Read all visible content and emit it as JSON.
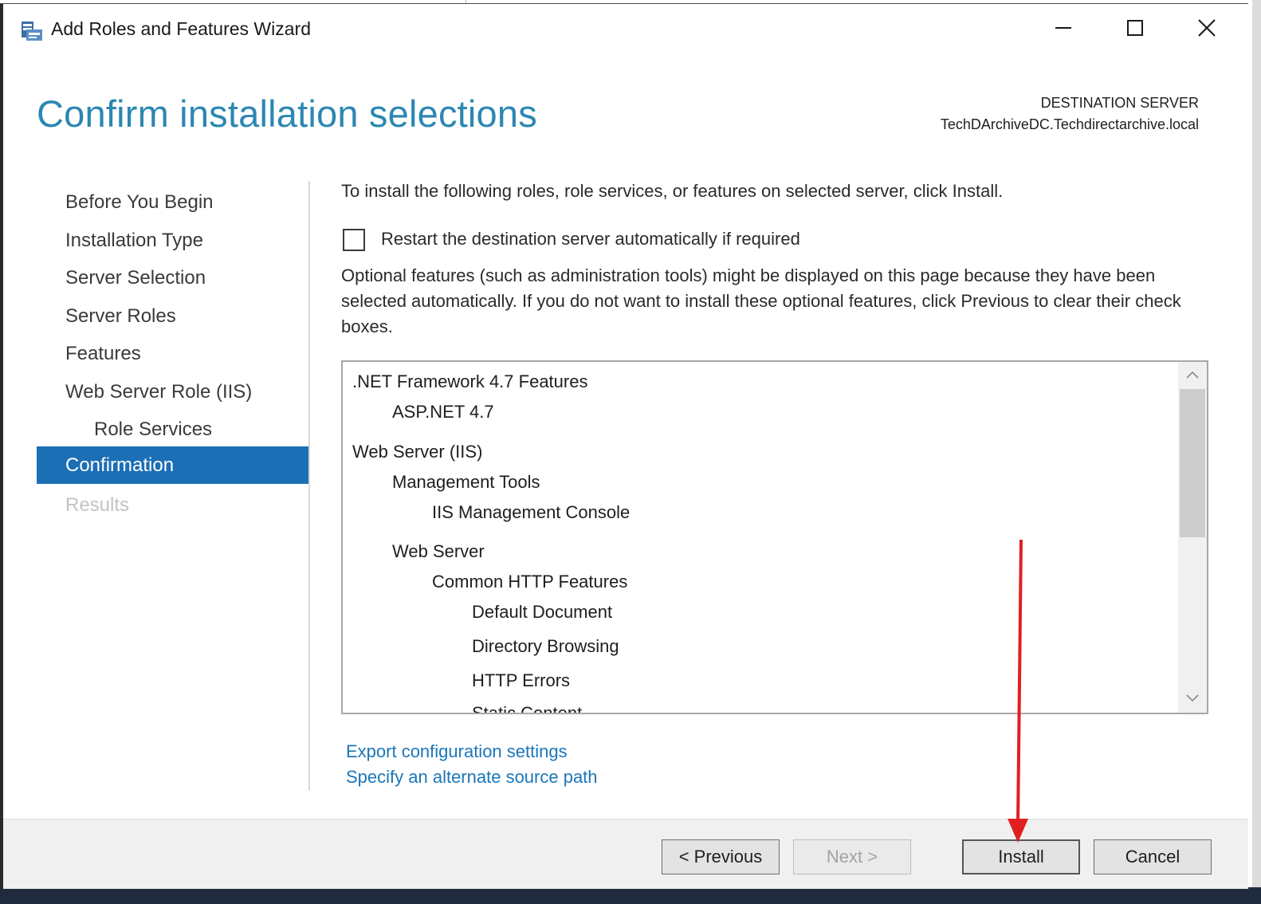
{
  "window": {
    "title": "Add Roles and Features Wizard",
    "minimize_icon": "minimize-icon",
    "maximize_icon": "maximize-icon",
    "close_icon": "close-icon"
  },
  "header": {
    "title": "Confirm installation selections",
    "destination_label": "DESTINATION SERVER",
    "destination_name": "TechDArchiveDC.Techdirectarchive.local"
  },
  "nav": {
    "items": [
      {
        "label": "Before You Begin",
        "state": "normal"
      },
      {
        "label": "Installation Type",
        "state": "normal"
      },
      {
        "label": "Server Selection",
        "state": "normal"
      },
      {
        "label": "Server Roles",
        "state": "normal"
      },
      {
        "label": "Features",
        "state": "normal"
      },
      {
        "label": "Web Server Role (IIS)",
        "state": "normal"
      },
      {
        "label": "Role Services",
        "state": "normal"
      },
      {
        "label": "Confirmation",
        "state": "active"
      },
      {
        "label": "Results",
        "state": "disabled"
      }
    ]
  },
  "main": {
    "instruction": "To install the following roles, role services, or features on selected server, click Install.",
    "restart_checkbox": {
      "label": "Restart the destination server automatically if required",
      "checked": false
    },
    "optional_note": "Optional features (such as administration tools) might be displayed on this page because they have been selected automatically. If you do not want to install these optional features, click Previous to clear their check boxes.",
    "selections": [
      {
        "label": ".NET Framework 4.7 Features",
        "level": 0
      },
      {
        "label": "ASP.NET 4.7",
        "level": 1
      },
      {
        "label": "Web Server (IIS)",
        "level": 0
      },
      {
        "label": "Management Tools",
        "level": 1
      },
      {
        "label": "IIS Management Console",
        "level": 2
      },
      {
        "label": "Web Server",
        "level": 1
      },
      {
        "label": "Common HTTP Features",
        "level": 2
      },
      {
        "label": "Default Document",
        "level": 3
      },
      {
        "label": "Directory Browsing",
        "level": 3
      },
      {
        "label": "HTTP Errors",
        "level": 3
      },
      {
        "label": "Static Content",
        "level": 3
      }
    ],
    "links": {
      "export": "Export configuration settings",
      "alternate_source": "Specify an alternate source path"
    }
  },
  "footer": {
    "previous": "< Previous",
    "next": "Next >",
    "install": "Install",
    "cancel": "Cancel"
  },
  "colors": {
    "title_blue": "#2c87b2",
    "nav_active_bg": "#1c6fb5",
    "link_blue": "#1b76b8",
    "annotation_red": "#e02020"
  }
}
